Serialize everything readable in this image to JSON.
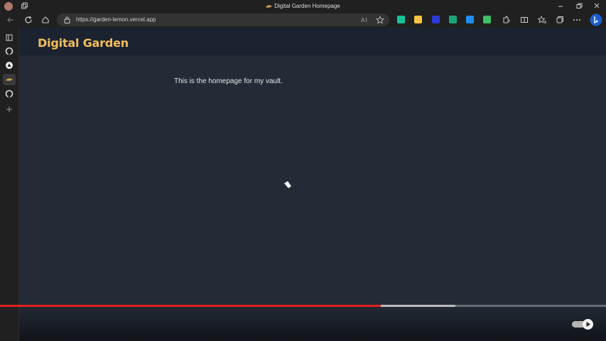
{
  "window": {
    "title": "Digital Garden Homepage",
    "controls": [
      "minimize-icon",
      "restore-icon",
      "close-icon"
    ]
  },
  "toolbar": {
    "url": "https://garden-lemon.vercel.app",
    "nav_icons": [
      "back-icon",
      "refresh-icon",
      "home-icon"
    ],
    "address_icons": [
      "read-aloud-icon",
      "favorite-star-icon"
    ],
    "extensions": [
      {
        "name": "grammarly-extension-icon",
        "color": "#15c39a"
      },
      {
        "name": "r-extension-icon",
        "color": "#f6c343"
      },
      {
        "name": "blue-extension-icon",
        "color": "#2a3bd6"
      },
      {
        "name": "m-extension-icon",
        "color": "#1aa57a"
      },
      {
        "name": "translate-extension-icon",
        "color": "#1f8ef1"
      },
      {
        "name": "green-extension-icon",
        "color": "#3cc06a"
      }
    ],
    "right_icons": [
      "extensions-icon",
      "split-screen-icon",
      "favorites-icon",
      "collections-icon",
      "more-icon",
      "bing-copilot-icon"
    ]
  },
  "sidebar": {
    "items": [
      {
        "icon": "tab-panel-icon"
      },
      {
        "icon": "github-icon"
      },
      {
        "icon": "obsidian-icon"
      },
      {
        "icon": "digital-garden-icon",
        "active": true
      },
      {
        "icon": "github-icon"
      },
      {
        "icon": "add-icon"
      }
    ]
  },
  "site": {
    "title": "Digital Garden",
    "body_text": "This is the homepage for my vault."
  },
  "player": {
    "played_fraction": 0.628,
    "buffered_fraction": 0.752,
    "autoplay_on": true
  },
  "colors": {
    "accent_title": "#f3bd5c",
    "page_bg": "#242b37",
    "header_bg": "#1c2330",
    "progress_played": "#e02020"
  }
}
